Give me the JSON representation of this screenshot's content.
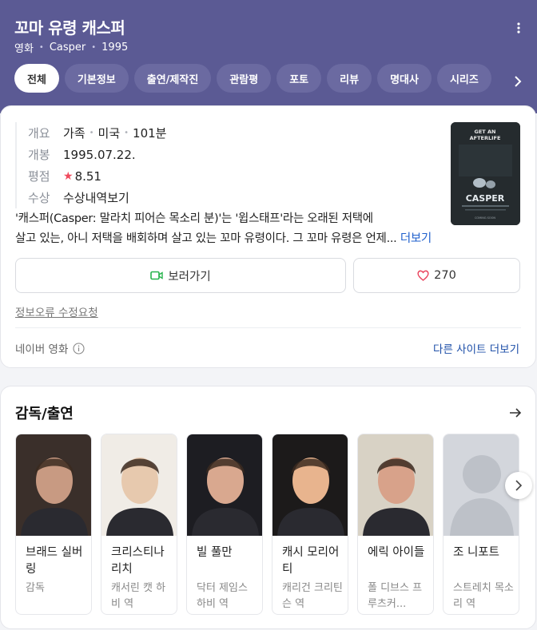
{
  "header": {
    "title": "꼬마 유령 캐스퍼",
    "category": "영화",
    "english_title": "Casper",
    "year": "1995",
    "tabs": [
      {
        "label": "전체",
        "active": true
      },
      {
        "label": "기본정보"
      },
      {
        "label": "출연/제작진"
      },
      {
        "label": "관람평"
      },
      {
        "label": "포토"
      },
      {
        "label": "리뷰"
      },
      {
        "label": "명대사"
      },
      {
        "label": "시리즈"
      }
    ]
  },
  "overview": {
    "rows": [
      {
        "key": "개요",
        "values": [
          "가족",
          "미국",
          "101분"
        ]
      },
      {
        "key": "개봉",
        "value": "1995.07.22."
      },
      {
        "key": "평점",
        "value": "8.51"
      },
      {
        "key": "수상",
        "value": "수상내역보기"
      }
    ],
    "poster": {
      "tagline": "GET AN AFTERLIFE",
      "title": "CASPER",
      "footer": "COMING SOON"
    },
    "synopsis_line1": "'캐스퍼(Casper: 말라치 피어슨 목소리 분)'는 '윕스태프'라는 오래된 저택에",
    "synopsis_line2": "살고 있는, 아니 저택을 배회하며 살고 있는 꼬마 유령이다. 그 꼬마 유령은 언제...",
    "more_label": "더보기",
    "watch_label": "보러가기",
    "like_count": "270",
    "report_label": "정보오류 수정요청",
    "source_label": "네이버 영화",
    "more_sites_label": "다른 사이트 더보기"
  },
  "cast": {
    "title": "감독/출연",
    "people": [
      {
        "name": "브래드 실버링",
        "role": "감독",
        "colors": [
          "#3a2f2a",
          "#c89a82"
        ]
      },
      {
        "name": "크리스티나 리치",
        "role": "캐서린 캣 하비 역",
        "colors": [
          "#f0ece6",
          "#e7c9ae"
        ]
      },
      {
        "name": "빌 풀만",
        "role": "닥터 제임스 하비 역",
        "colors": [
          "#1d1d22",
          "#d9a88f"
        ]
      },
      {
        "name": "캐시 모리어티",
        "role": "캐리건 크리틴슨 역",
        "colors": [
          "#1c1a1a",
          "#e8b48e"
        ]
      },
      {
        "name": "에릭 아이들",
        "role": "폴 디브스 프루츠커...",
        "colors": [
          "#d8d2c5",
          "#d8a28a"
        ]
      },
      {
        "name": "조 니포트",
        "role": "스트레치 목소리 역",
        "colors": [
          "#cfd2d8",
          "#b9bcc4"
        ]
      }
    ]
  }
}
